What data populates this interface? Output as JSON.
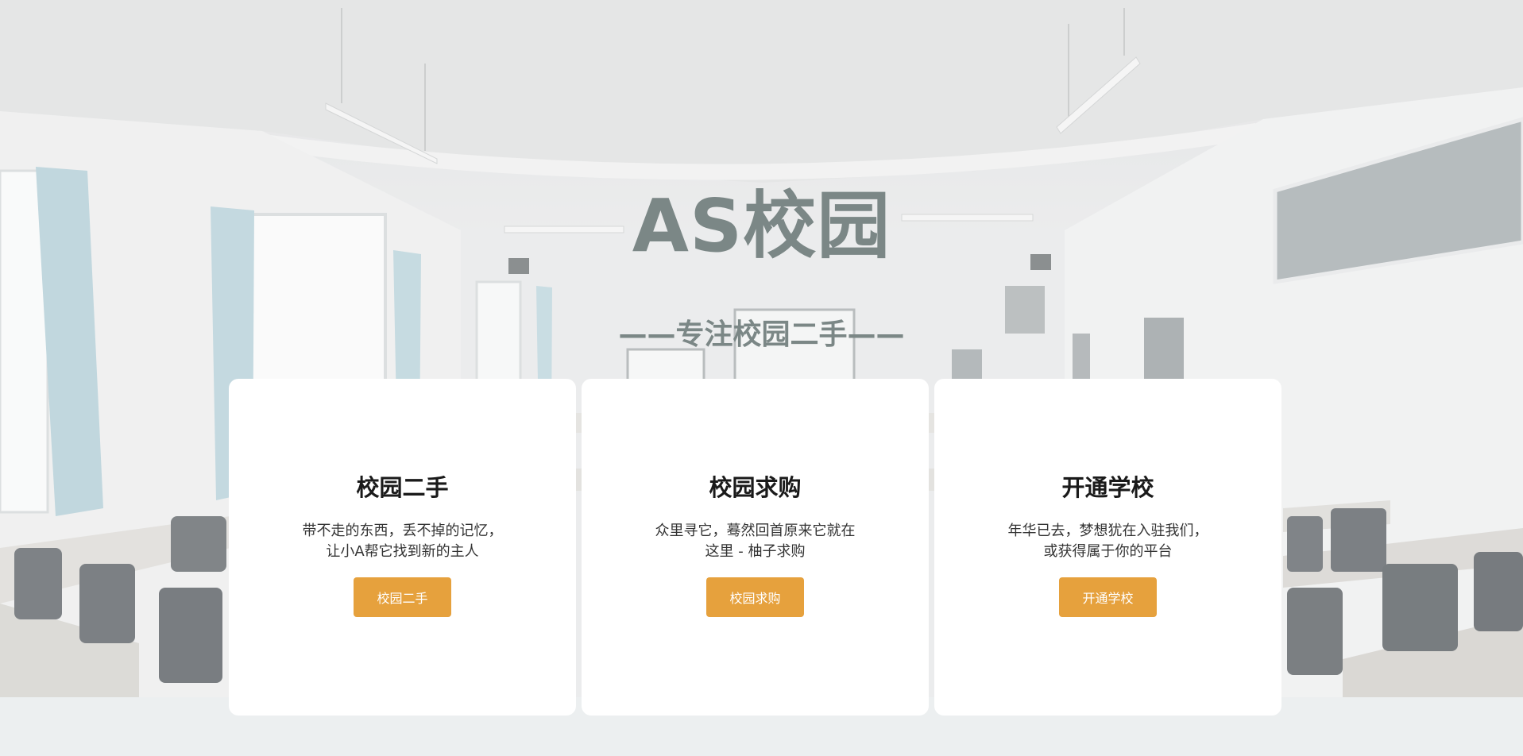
{
  "hero": {
    "title": "AS校园",
    "subtitle": "——专注校园二手——"
  },
  "cards": [
    {
      "title": "校园二手",
      "description": "带不走的东西，丢不掉的记忆，让小A帮它找到新的主人",
      "button_label": "校园二手"
    },
    {
      "title": "校园求购",
      "description": "众里寻它，蓦然回首原来它就在这里 - 柚子求购",
      "button_label": "校园求购"
    },
    {
      "title": "开通学校",
      "description": "年华已去，梦想犹在入驻我们，或获得属于你的平台",
      "button_label": "开通学校"
    }
  ],
  "colors": {
    "accent": "#e6a13d",
    "title": "#7b8786",
    "footer_band": "#eceff0"
  }
}
